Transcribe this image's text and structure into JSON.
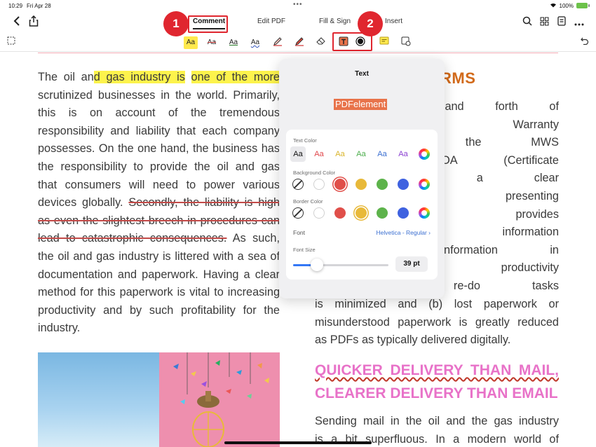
{
  "status_bar": {
    "time": "10:29",
    "date": "Fri Apr 28",
    "battery": "100%"
  },
  "nav": {
    "tabs": [
      "Comment",
      "Edit PDF",
      "Fill & Sign",
      "Insert"
    ],
    "active_tab": "Comment"
  },
  "callouts": [
    "1",
    "2"
  ],
  "toolbar": {
    "text_tools": [
      "Aa",
      "Aa",
      "Aa",
      "Aa"
    ]
  },
  "document": {
    "left_column": [
      {
        "segments": [
          {
            "text": "The oil an",
            "style": ""
          },
          {
            "text": "d gas industry is",
            "style": "hl"
          },
          {
            "text": " ",
            "style": ""
          },
          {
            "text": "one of the more",
            "style": "hl"
          }
        ]
      },
      {
        "segments": [
          {
            "text": "scrutinized businesses in the world. Primarily,",
            "style": ""
          }
        ]
      },
      {
        "segments": [
          {
            "text": "this is on account of the tremendous",
            "style": ""
          }
        ]
      },
      {
        "segments": [
          {
            "text": "responsibility and liability that each company",
            "style": ""
          }
        ]
      },
      {
        "segments": [
          {
            "text": "possesses. On the one hand, the business has",
            "style": ""
          }
        ]
      },
      {
        "segments": [
          {
            "text": "the responsibility to provide the oil and gas",
            "style": ""
          }
        ]
      },
      {
        "segments": [
          {
            "text": "that consumers will need to power various",
            "style": ""
          }
        ]
      },
      {
        "segments": [
          {
            "text": "devices globally. ",
            "style": ""
          },
          {
            "text": "Secondly, the liability is high",
            "style": "strike"
          }
        ]
      },
      {
        "segments": [
          {
            "text": "as even the slightest breech in procedures can",
            "style": "strike"
          }
        ]
      },
      {
        "segments": [
          {
            "text": "lead to catastrophic consequences.",
            "style": "strike"
          },
          {
            "text": " As such,",
            "style": ""
          }
        ]
      },
      {
        "segments": [
          {
            "text": "the oil and gas industry is littered with a sea of",
            "style": ""
          }
        ]
      },
      {
        "segments": [
          {
            "text": "documentation and paperwork. Having a clear",
            "style": ""
          }
        ]
      },
      {
        "segments": [
          {
            "text": "method for this paperwork is vital to increasing",
            "style": ""
          }
        ]
      },
      {
        "segments": [
          {
            "text": "productivity and by such profitability for the",
            "style": ""
          }
        ]
      },
      {
        "segments": [
          {
            "text": "industry.",
            "style": ""
          }
        ]
      }
    ],
    "right_heading": "RMS",
    "right_column_top": [
      "y a back and forth of",
      "S (Managing Warranty",
      "urer. Since the MWS",
      "ave a COA (Certificate",
      "oil transport, a clear",
      "ology for presenting",
      "PDFElement provides",
      "o present information",
      "g the information in",
      "layout, productivity",
      "need to re-do tasks"
    ],
    "right_column_bottom": [
      "is minimized and (b) lost paperwork or",
      "misunderstood paperwork is greatly reduced",
      "as PDFs as typically delivered digitally."
    ],
    "pink_heading": [
      "QUICKER DELIVERY THAN MAIL,",
      "CLEARER DELIVERY THAN EMAIL"
    ],
    "right_column_end": [
      "Sending mail in the oil and the gas industry",
      "is a bit superfluous. In a modern world of"
    ]
  },
  "popover": {
    "title": "Text",
    "preview_text": "PDFelement",
    "text_color_label": "Text Color",
    "text_colors": [
      "#111111",
      "#e0464a",
      "#d9b42a",
      "#4cae4c",
      "#3b6fd1",
      "#8a3fd1"
    ],
    "swatch_text": "Aa",
    "background_color_label": "Background Color",
    "background_colors": [
      "none",
      "#ffffff",
      "#e04f4a",
      "#e8b93a",
      "#5db34b",
      "#3f62e0",
      "rainbow"
    ],
    "border_color_label": "Border Color",
    "border_colors": [
      "none",
      "#ffffff",
      "#e04f4a",
      "#e8b93a",
      "#5db34b",
      "#3f62e0",
      "rainbow"
    ],
    "font_label": "Font",
    "font_value": "Helvetica - Regular",
    "font_size_label": "Font Size",
    "font_size_value": "39 pt",
    "font_size_fraction": 0.25
  }
}
